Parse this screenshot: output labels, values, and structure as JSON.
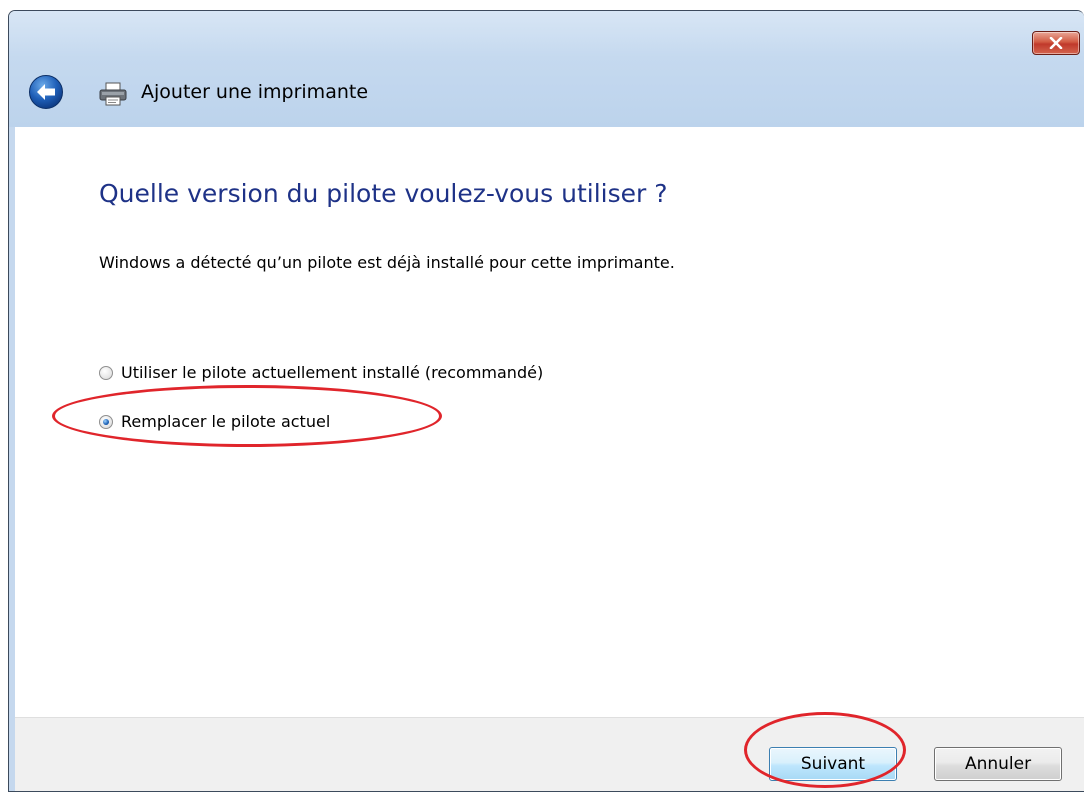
{
  "window": {
    "title": "Ajouter une imprimante"
  },
  "content": {
    "heading": "Quelle version du pilote voulez-vous utiliser ?",
    "description": "Windows a détecté qu’un pilote est déjà installé pour cette imprimante.",
    "options": [
      {
        "label": "Utiliser le pilote actuellement installé (recommandé)",
        "selected": false
      },
      {
        "label": "Remplacer le pilote actuel",
        "selected": true
      }
    ]
  },
  "buttons": {
    "next": "Suivant",
    "cancel": "Annuler"
  },
  "icons": {
    "close": "close-icon",
    "back": "back-arrow-icon",
    "printer": "printer-icon"
  },
  "colors": {
    "heading": "#1e3287",
    "annotation": "#e0252b",
    "titlebar": "#c5d9ef"
  }
}
